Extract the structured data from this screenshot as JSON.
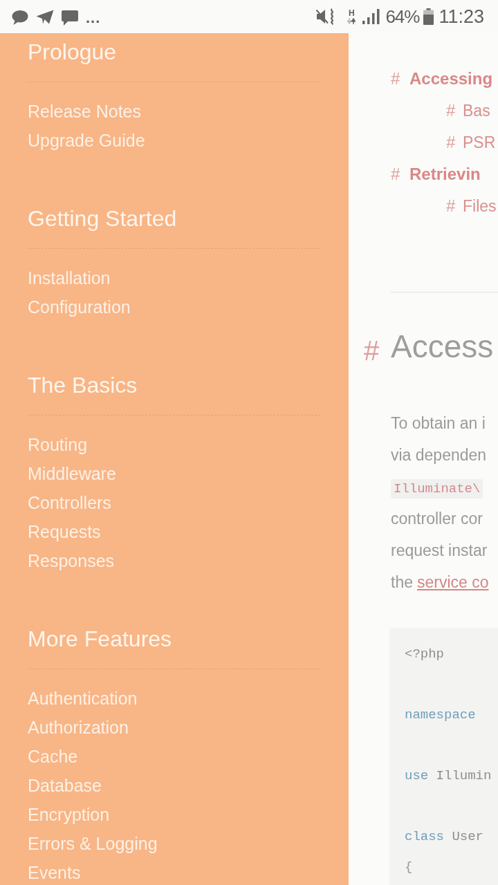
{
  "status_bar": {
    "overflow": "...",
    "network_type": "H",
    "battery": "64%",
    "time": "11:23"
  },
  "sidebar": {
    "sections": [
      {
        "title": "Prologue",
        "items": [
          "Release Notes",
          "Upgrade Guide"
        ]
      },
      {
        "title": "Getting Started",
        "items": [
          "Installation",
          "Configuration"
        ]
      },
      {
        "title": "The Basics",
        "items": [
          "Routing",
          "Middleware",
          "Controllers",
          "Requests",
          "Responses"
        ]
      },
      {
        "title": "More Features",
        "items": [
          "Authentication",
          "Authorization",
          "Cache",
          "Database",
          "Encryption",
          "Errors & Logging",
          "Events"
        ]
      }
    ]
  },
  "content": {
    "toc": [
      {
        "marker": "#",
        "label": "Accessing",
        "children": [
          {
            "marker": "#",
            "label": "Bas"
          },
          {
            "marker": "#",
            "label": "PSR"
          }
        ]
      },
      {
        "marker": "#",
        "label": "Retrievin",
        "children": [
          {
            "marker": "#",
            "label": "Files"
          }
        ]
      }
    ],
    "heading": {
      "marker": "#",
      "text": "Access"
    },
    "paragraph": [
      {
        "segments": [
          {
            "kind": "text",
            "text": "To obtain an i"
          }
        ]
      },
      {
        "segments": [
          {
            "kind": "text",
            "text": "via dependen"
          }
        ]
      },
      {
        "segments": [
          {
            "kind": "code",
            "text": "Illuminate\\"
          }
        ]
      },
      {
        "segments": [
          {
            "kind": "text",
            "text": "controller cor"
          }
        ]
      },
      {
        "segments": [
          {
            "kind": "text",
            "text": "request instar"
          }
        ]
      },
      {
        "segments": [
          {
            "kind": "text",
            "text": "the"
          },
          {
            "kind": "link",
            "text": "service co"
          }
        ]
      }
    ],
    "code_block": [
      {
        "kind": "code",
        "tokens": [
          {
            "kind": "plain",
            "text": "<?php"
          }
        ]
      },
      {
        "kind": "blank"
      },
      {
        "kind": "code",
        "tokens": [
          {
            "kind": "keyword",
            "text": "namespace"
          }
        ]
      },
      {
        "kind": "blank"
      },
      {
        "kind": "code",
        "tokens": [
          {
            "kind": "keyword",
            "text": "use"
          },
          {
            "kind": "plain",
            "text": "Illumin"
          }
        ]
      },
      {
        "kind": "blank"
      },
      {
        "kind": "code",
        "tokens": [
          {
            "kind": "keyword",
            "text": "class"
          },
          {
            "kind": "plain",
            "text": "User"
          }
        ]
      },
      {
        "kind": "code",
        "tokens": [
          {
            "kind": "punct",
            "text": "{"
          }
        ]
      }
    ]
  }
}
